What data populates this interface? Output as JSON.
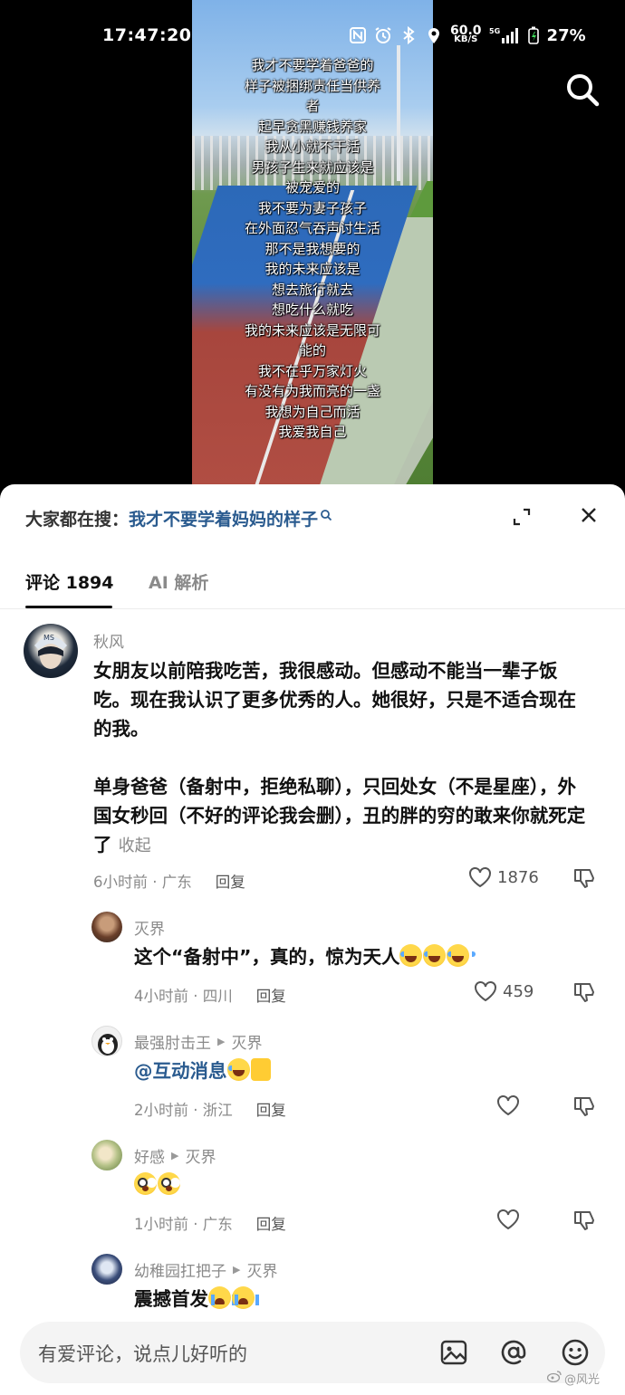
{
  "status_bar": {
    "time": "17:47:20",
    "speed_value": "60.0",
    "speed_unit": "KB/S",
    "network": "5G",
    "battery": "27%"
  },
  "video": {
    "lyrics": [
      "我才不要学着爸爸的",
      "样子被捆绑责任当供养",
      "者",
      "起早贪黑赚钱养家",
      "我从小就不干活",
      "男孩子生来就应该是",
      "被宠爱的",
      "我不要为妻子孩子",
      "在外面忍气吞声讨生活",
      "那不是我想要的",
      "我的未来应该是",
      "想去旅行就去",
      "想吃什么就吃",
      "我的未来应该是无限可",
      "能的",
      "我不在乎万家灯火",
      "有没有为我而亮的一盏",
      "我想为自己而活",
      "我爱我自己"
    ],
    "search_icon": "search-icon"
  },
  "sheet": {
    "hot_search_prefix": "大家都在搜：",
    "hot_search_term": "我才不要学着妈妈的样子",
    "tabs": [
      {
        "label": "评论 1894",
        "active": true
      },
      {
        "label": "AI 解析",
        "active": false
      }
    ]
  },
  "comments": [
    {
      "name": "秋风",
      "text_p1": "女朋友以前陪我吃苦，我很感动。但感动不能当一辈子饭吃。现在我认识了更多优秀的人。她很好，只是不适合现在的我。",
      "text_p2": "单身爸爸（备射中，拒绝私聊），只回处女（不是星座），外国女秒回（不好的评论我会删），丑的胖的穷的敢来你就死定了",
      "fold": "收起",
      "time": "6小时前 · 广东",
      "reply": "回复",
      "likes": "1876"
    },
    {
      "name": "灭界",
      "text": "这个“备射中”，真的，惊为天人",
      "time": "4小时前 · 四川",
      "reply": "回复",
      "likes": "459"
    },
    {
      "name": "最强肘击王",
      "reply_to": "灭界",
      "text": "@互动消息",
      "time": "2小时前 · 浙江",
      "reply": "回复"
    },
    {
      "name": "好感",
      "reply_to": "灭界",
      "text": "",
      "time": "1小时前 · 广东",
      "reply": "回复"
    },
    {
      "name": "幼稚园扛把子",
      "reply_to": "灭界",
      "text": "震撼首发"
    }
  ],
  "input_bar": {
    "placeholder": "有爱评论，说点儿好听的"
  },
  "watermark": "@风光"
}
